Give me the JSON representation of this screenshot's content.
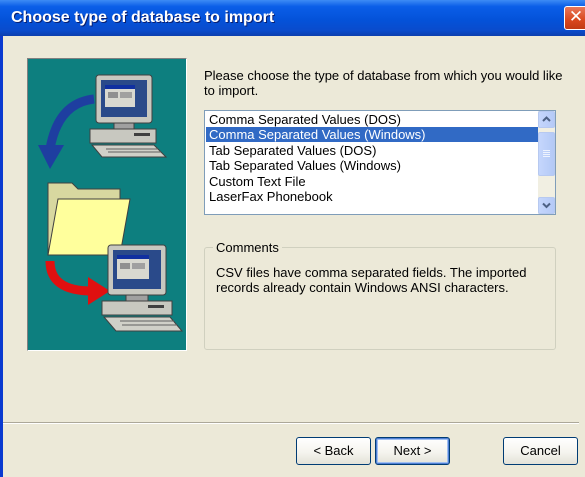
{
  "window": {
    "title": "Choose type of database to import",
    "close_glyph": "✕"
  },
  "colors": {
    "titlebar": "#0452d9",
    "client_bg": "#ece9d8",
    "art_bg": "#0d7f7f",
    "selection": "#316ac5"
  },
  "instruction": "Please choose the type of database from which you would like to import.",
  "database_list": {
    "items": [
      "Comma Separated Values (DOS)",
      "Comma Separated Values (Windows)",
      "Tab Separated Values (DOS)",
      "Tab Separated Values (Windows)",
      "Custom Text File",
      "LaserFax Phonebook"
    ],
    "selected_index": 1
  },
  "comments": {
    "label": "Comments",
    "text": "CSV files have comma separated fields. The imported records already contain Windows ANSI characters."
  },
  "buttons": {
    "back": "< Back",
    "next": "Next >",
    "cancel": "Cancel"
  },
  "icons": {
    "close": "close-icon",
    "scroll_up": "chevron-up-icon",
    "scroll_down": "chevron-down-icon",
    "art": [
      "computer-icon",
      "folder-icon",
      "blue-arrow-icon",
      "red-arrow-icon"
    ]
  }
}
